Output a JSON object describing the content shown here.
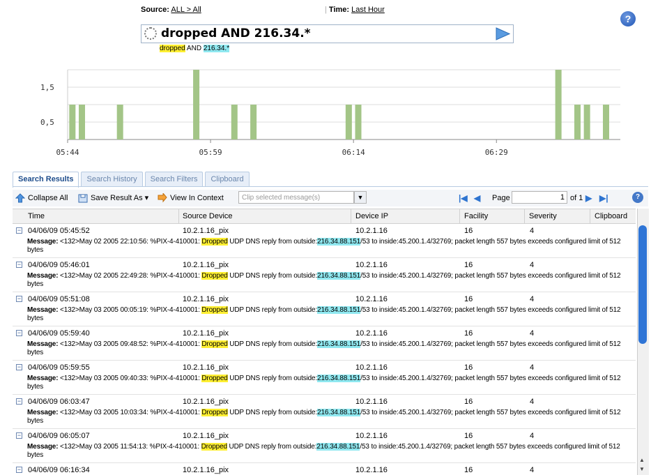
{
  "header": {
    "source_label": "Source:",
    "source_value": "ALL > All",
    "time_label": "Time:",
    "time_value": "Last Hour",
    "help_icon": "help-icon"
  },
  "query": {
    "text": "dropped AND 216.34.*",
    "hint_word1": "dropped",
    "hint_and": " AND ",
    "hint_word2": "216.34.*"
  },
  "chart_data": {
    "type": "bar",
    "ylim": [
      0,
      2
    ],
    "yticks": [
      "0,5",
      "1,5"
    ],
    "xticks": [
      "05:44",
      "05:59",
      "06:14",
      "06:29"
    ],
    "bar_color": "#a3c587",
    "x": [
      0.5,
      1.5,
      5.5,
      13.5,
      17.5,
      19.5,
      29.5,
      30.5,
      51.5,
      53.5,
      54.5,
      56.5
    ],
    "values": [
      1,
      1,
      1,
      2,
      1,
      1,
      1,
      1,
      2,
      1,
      1,
      1
    ],
    "x_span_minutes": 58
  },
  "tabs": [
    "Search Results",
    "Search History",
    "Search Filters",
    "Clipboard"
  ],
  "toolbar": {
    "collapse_all": "Collapse All",
    "save_result_as": "Save Result As",
    "view_in_context": "View In Context",
    "clip_placeholder": "Clip selected message(s)",
    "page_label": "Page",
    "page_value": "1",
    "page_of": "of 1"
  },
  "columns": [
    "Time",
    "Source Device",
    "Device IP",
    "Facility",
    "Severity",
    "Clipboard"
  ],
  "rows": [
    {
      "time": "04/06/09 05:45:52",
      "device": "10.2.1.16_pix",
      "ip": "10.2.1.16",
      "facility": "16",
      "severity": "4",
      "msg_pre": "<132>May 02 2005 22:10:56: %PIX-4-410001: ",
      "msg_hl1": "Dropped",
      "msg_mid": " UDP DNS reply from outside:",
      "msg_hl2": "216.34.88.151",
      "msg_post": "/53 to inside:45.200.1.4/32769; packet length 557 bytes exceeds configured limit of 512 bytes"
    },
    {
      "time": "04/06/09 05:46:01",
      "device": "10.2.1.16_pix",
      "ip": "10.2.1.16",
      "facility": "16",
      "severity": "4",
      "msg_pre": "<132>May 02 2005 22:49:28: %PIX-4-410001: ",
      "msg_hl1": "Dropped",
      "msg_mid": " UDP DNS reply from outside:",
      "msg_hl2": "216.34.88.151",
      "msg_post": "/53 to inside:45.200.1.4/32769; packet length 557 bytes exceeds configured limit of 512 bytes"
    },
    {
      "time": "04/06/09 05:51:08",
      "device": "10.2.1.16_pix",
      "ip": "10.2.1.16",
      "facility": "16",
      "severity": "4",
      "msg_pre": "<132>May 03 2005 00:05:19: %PIX-4-410001: ",
      "msg_hl1": "Dropped",
      "msg_mid": " UDP DNS reply from outside:",
      "msg_hl2": "216.34.88.151",
      "msg_post": "/53 to inside:45.200.1.4/32769; packet length 557 bytes exceeds configured limit of 512 bytes"
    },
    {
      "time": "04/06/09 05:59:40",
      "device": "10.2.1.16_pix",
      "ip": "10.2.1.16",
      "facility": "16",
      "severity": "4",
      "msg_pre": "<132>May 03 2005 09:48:52: %PIX-4-410001: ",
      "msg_hl1": "Dropped",
      "msg_mid": " UDP DNS reply from outside:",
      "msg_hl2": "216.34.88.151",
      "msg_post": "/53 to inside:45.200.1.4/32769; packet length 557 bytes exceeds configured limit of 512 bytes"
    },
    {
      "time": "04/06/09 05:59:55",
      "device": "10.2.1.16_pix",
      "ip": "10.2.1.16",
      "facility": "16",
      "severity": "4",
      "msg_pre": "<132>May 03 2005 09:40:33: %PIX-4-410001: ",
      "msg_hl1": "Dropped",
      "msg_mid": " UDP DNS reply from outside:",
      "msg_hl2": "216.34.88.151",
      "msg_post": "/53 to inside:45.200.1.4/32769; packet length 557 bytes exceeds configured limit of 512 bytes"
    },
    {
      "time": "04/06/09 06:03:47",
      "device": "10.2.1.16_pix",
      "ip": "10.2.1.16",
      "facility": "16",
      "severity": "4",
      "msg_pre": "<132>May 03 2005 10:03:34: %PIX-4-410001: ",
      "msg_hl1": "Dropped",
      "msg_mid": " UDP DNS reply from outside:",
      "msg_hl2": "216.34.88.151",
      "msg_post": "/53 to inside:45.200.1.4/32769; packet length 557 bytes exceeds configured limit of 512 bytes"
    },
    {
      "time": "04/06/09 06:05:07",
      "device": "10.2.1.16_pix",
      "ip": "10.2.1.16",
      "facility": "16",
      "severity": "4",
      "msg_pre": "<132>May 03 2005 11:54:13: %PIX-4-410001: ",
      "msg_hl1": "Dropped",
      "msg_mid": " UDP DNS reply from outside:",
      "msg_hl2": "216.34.88.151",
      "msg_post": "/53 to inside:45.200.1.4/32769; packet length 557 bytes exceeds configured limit of 512 bytes"
    },
    {
      "time": "04/06/09 06:16:34",
      "device": "10.2.1.16_pix",
      "ip": "10.2.1.16",
      "facility": "16",
      "severity": "4",
      "msg_pre": "",
      "msg_hl1": "",
      "msg_mid": "",
      "msg_hl2": "",
      "msg_post": ""
    }
  ],
  "message_label": "Message:"
}
